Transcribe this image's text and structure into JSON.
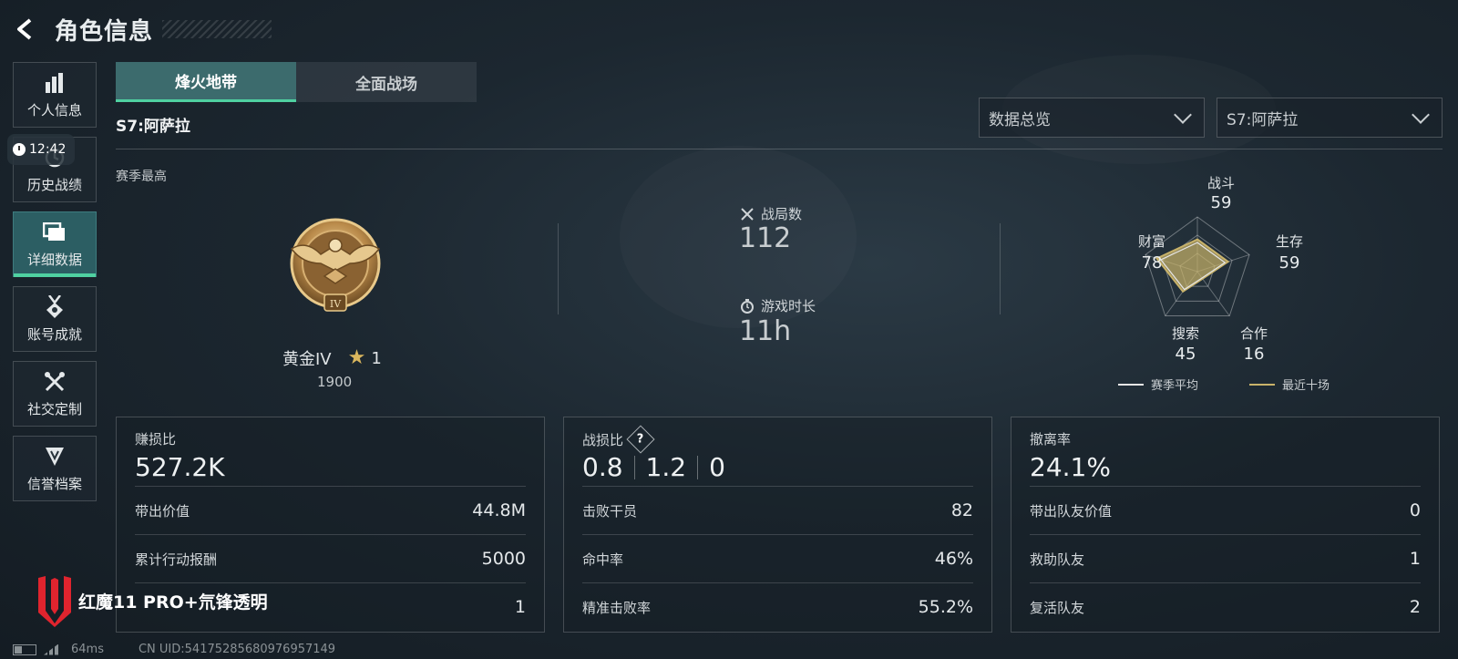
{
  "header": {
    "title": "角色信息"
  },
  "clock": {
    "time": "12:42"
  },
  "sidebar": {
    "items": [
      {
        "label": "个人信息",
        "icon": "bar-chart-icon"
      },
      {
        "label": "历史战绩",
        "icon": "history-icon"
      },
      {
        "label": "详细数据",
        "icon": "folder-icon",
        "active": true
      },
      {
        "label": "账号成就",
        "icon": "medal-icon"
      },
      {
        "label": "社交定制",
        "icon": "tools-icon"
      },
      {
        "label": "信誉档案",
        "icon": "shield-icon"
      }
    ]
  },
  "tabs": [
    {
      "label": "烽火地带",
      "active": true
    },
    {
      "label": "全面战场",
      "active": false
    }
  ],
  "season_label": "S7:阿萨拉",
  "filters": {
    "view": "数据总览",
    "season": "S7:阿萨拉"
  },
  "overview": {
    "section_label": "赛季最高",
    "rank_name": "黄金IV",
    "rank_stars": "1",
    "rank_score": "1900",
    "battles_label": "战局数",
    "battles_value": "112",
    "playtime_label": "游戏时长",
    "playtime_value": "11h"
  },
  "radar": {
    "axes": [
      {
        "label": "战斗",
        "value": "59"
      },
      {
        "label": "生存",
        "value": "59"
      },
      {
        "label": "合作",
        "value": "16"
      },
      {
        "label": "搜索",
        "value": "45"
      },
      {
        "label": "财富",
        "value": "78"
      }
    ],
    "values": [
      59,
      59,
      16,
      45,
      78
    ],
    "legend": {
      "season_avg": "赛季平均",
      "recent_ten": "最近十场"
    },
    "colors": {
      "recent": "#c9b36a",
      "avg": "#e6e6e6"
    }
  },
  "cards": {
    "profit": {
      "title": "赚损比",
      "value": "527.2K",
      "rows": [
        {
          "label": "带出价值",
          "value": "44.8M"
        },
        {
          "label": "累计行动报酬",
          "value": "5000"
        },
        {
          "label": "",
          "value": "1"
        }
      ]
    },
    "kd": {
      "title": "战损比",
      "values": [
        "0.8",
        "1.2",
        "0"
      ],
      "rows": [
        {
          "label": "击败干员",
          "value": "82"
        },
        {
          "label": "命中率",
          "value": "46%"
        },
        {
          "label": "精准击败率",
          "value": "55.2%"
        }
      ]
    },
    "extract": {
      "title": "撤离率",
      "value": "24.1%",
      "rows": [
        {
          "label": "带出队友价值",
          "value": "0"
        },
        {
          "label": "救助队友",
          "value": "1"
        },
        {
          "label": "复活队友",
          "value": "2"
        }
      ]
    }
  },
  "brand": {
    "text": "红魔11 PRO+氘锋透明"
  },
  "footer": {
    "ping": "64ms",
    "uid": "CN UID:54175285680976957149"
  },
  "colors": {
    "accent": "#4fd1a1",
    "tab_active": "#3c6b6d",
    "gold": "#d9b65d"
  }
}
